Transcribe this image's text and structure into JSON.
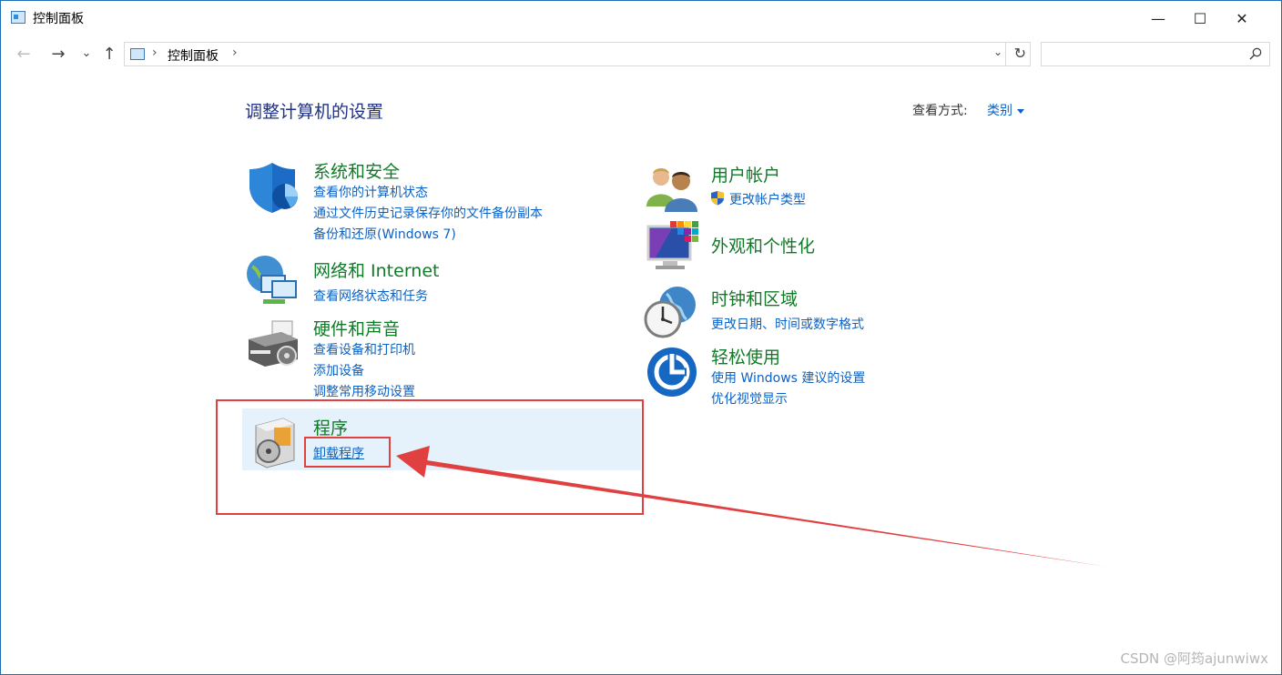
{
  "window": {
    "title": "控制面板",
    "controls": {
      "minimize": "—",
      "maximize": "☐",
      "close": "✕"
    }
  },
  "address": {
    "nav": {
      "back": "←",
      "forward": "→",
      "recent": "⌄",
      "up": "↑"
    },
    "breadcrumb": [
      "控制面板"
    ],
    "separator": "›",
    "search_placeholder": ""
  },
  "page": {
    "title": "调整计算机的设置",
    "view_by_label": "查看方式:",
    "view_by_value": "类别"
  },
  "categories": [
    {
      "title": "系统和安全",
      "icon": "shield-icon",
      "links": [
        "查看你的计算机状态",
        "通过文件历史记录保存你的文件备份副本",
        "备份和还原(Windows 7)"
      ]
    },
    {
      "title": "网络和 Internet",
      "icon": "network-icon",
      "links": [
        "查看网络状态和任务"
      ]
    },
    {
      "title": "硬件和声音",
      "icon": "printer-icon",
      "links": [
        "查看设备和打印机",
        "添加设备",
        "调整常用移动设置"
      ]
    },
    {
      "title": "程序",
      "icon": "programs-icon",
      "links": [
        "卸载程序"
      ]
    },
    {
      "title": "用户帐户",
      "icon": "users-icon",
      "links": [
        "更改帐户类型"
      ]
    },
    {
      "title": "外观和个性化",
      "icon": "display-icon",
      "links": []
    },
    {
      "title": "时钟和区域",
      "icon": "clock-globe-icon",
      "links": [
        "更改日期、时间或数字格式"
      ]
    },
    {
      "title": "轻松使用",
      "icon": "ease-of-access-icon",
      "links": [
        "使用 Windows 建议的设置",
        "优化视觉显示"
      ]
    }
  ],
  "watermark": "CSDN @阿筠ajunwiwx",
  "colors": {
    "category_title": "#117a28",
    "link": "#0b62c4",
    "page_title": "#1e3287",
    "annotation": "#e0403f",
    "hover": "#e5f1fb"
  }
}
